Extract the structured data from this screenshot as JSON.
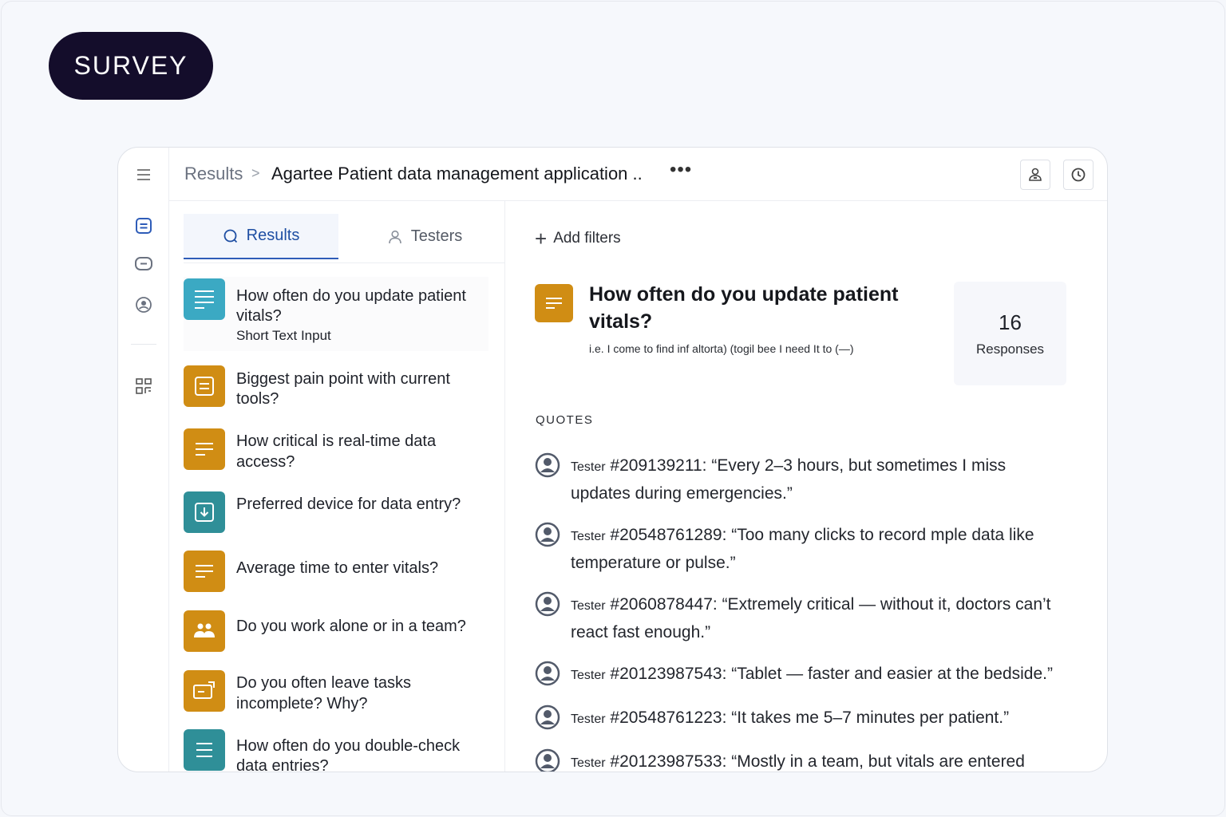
{
  "badge": "SURVEY",
  "header": {
    "breadcrumb_root": "Results",
    "breadcrumb_sep": ">",
    "title": "Agartee Patient data management application ..",
    "more": "•••",
    "icons": [
      "user-badge-icon",
      "clock-icon"
    ]
  },
  "rail": {
    "icons": [
      "menu-icon",
      "list-icon",
      "chat-icon",
      "user-circle-icon",
      "grid-icon"
    ]
  },
  "tabs": [
    {
      "label": "Results",
      "icon": "search-icon",
      "active": true
    },
    {
      "label": "Testers",
      "icon": "user-icon",
      "active": false
    }
  ],
  "questions": [
    {
      "line1": "How often do you update  patient",
      "line2": "vitals?",
      "type": "Short Text Input",
      "icon": "text-lines-icon",
      "color": "#3ba9c3"
    },
    {
      "line1": "Biggest pain point with current",
      "line2": "tools?",
      "icon": "form-icon",
      "color": "#d08d14"
    },
    {
      "line1": "How critical is real-time data",
      "line2": "access?",
      "icon": "text-lines-icon",
      "color": "#d08d14"
    },
    {
      "line1": "Preferred device for data entry?",
      "line2": "",
      "icon": "download-box-icon",
      "color": "#2f8f98"
    },
    {
      "line1": "Average time to enter vitals?",
      "line2": "",
      "icon": "text-lines-icon",
      "color": "#d08d14"
    },
    {
      "line1": "Do you work alone or in a team?",
      "line2": "",
      "icon": "team-icon",
      "color": "#d08d14"
    },
    {
      "line1": "Do you often leave tasks",
      "line2": "incomplete? Why?",
      "icon": "export-icon",
      "color": "#d08d14"
    },
    {
      "line1": "How often do you double-check",
      "line2": "data entries?",
      "icon": "list-lines-icon",
      "color": "#2f8f98"
    }
  ],
  "detail": {
    "add_filters": "Add filters",
    "title_line1": "How often do you update patient",
    "title_line2": "vitals?",
    "description": "i.e. I come to find inf  altorta) (togil bee I need  It to  (—)",
    "responses_count": "16",
    "responses_label": "Responses",
    "quotes_heading": "QUOTES"
  },
  "quotes": [
    {
      "prefix": "Tester",
      "id": "#209139211:",
      "line1": " “Every 2–3 hours, but sometimes I miss",
      "line2": "updates during emergencies.”"
    },
    {
      "prefix": "Tester",
      "id": "#20548761289:",
      "line1": " “Too many clicks to record mple data like",
      "line2": "temperature or pulse.”"
    },
    {
      "prefix": "Tester",
      "id": "#2060878447:",
      "line1": " “Extremely critical — without it, doctors can’t",
      "line2": "react fast enough.”"
    },
    {
      "prefix": "Tester",
      "id": "#20123987543:",
      "line1": " “Tablet — faster and easier at the bedside.”",
      "line2": ""
    },
    {
      "prefix": "Tester",
      "id": "#20548761223:",
      "line1": " “It takes me 5–7 minutes per patient.”",
      "line2": ""
    },
    {
      "prefix": "Tester",
      "id": "#20123987533:",
      "line1": " “Mostly in a team, but vitals are entered",
      "line2": ""
    }
  ]
}
